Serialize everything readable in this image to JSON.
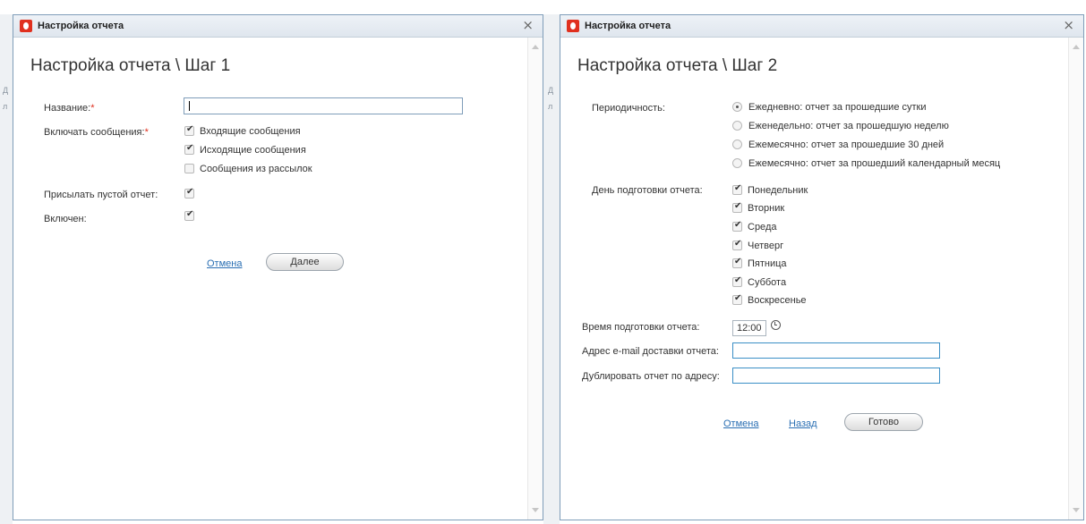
{
  "background": {
    "glimpse_left": [
      "Д",
      "л"
    ],
    "glimpse_right": [
      "Д",
      "л"
    ]
  },
  "dialog1": {
    "title": "Настройка отчета",
    "close": "×",
    "heading": "Настройка отчета \\ Шаг 1",
    "name_label": "Название:",
    "name_value": "",
    "include_label": "Включать сообщения:",
    "required_mark": "*",
    "messages": [
      {
        "label": "Входящие сообщения",
        "checked": true
      },
      {
        "label": "Исходящие сообщения",
        "checked": true
      },
      {
        "label": "Сообщения из рассылок",
        "checked": false
      }
    ],
    "send_empty_label": "Присылать пустой отчет:",
    "send_empty_checked": true,
    "enabled_label": "Включен:",
    "enabled_checked": true,
    "cancel_label": "Отмена",
    "next_label": "Далее"
  },
  "dialog2": {
    "title": "Настройка отчета",
    "close": "×",
    "heading": "Настройка отчета \\ Шаг 2",
    "periodicity_label": "Периодичность:",
    "periodicity_options": [
      {
        "label": "Ежедневно: отчет за прошедшие сутки",
        "selected": true
      },
      {
        "label": "Еженедельно: отчет за прошедшую неделю",
        "selected": false
      },
      {
        "label": "Ежемесячно: отчет за прошедшие 30 дней",
        "selected": false
      },
      {
        "label": "Ежемесячно: отчет за прошедший календарный месяц",
        "selected": false
      }
    ],
    "day_label": "День подготовки отчета:",
    "days": [
      {
        "label": "Понедельник",
        "checked": true
      },
      {
        "label": "Вторник",
        "checked": true
      },
      {
        "label": "Среда",
        "checked": true
      },
      {
        "label": "Четверг",
        "checked": true
      },
      {
        "label": "Пятница",
        "checked": true
      },
      {
        "label": "Суббота",
        "checked": true
      },
      {
        "label": "Воскресенье",
        "checked": true
      }
    ],
    "time_label": "Время подготовки отчета:",
    "time_value": "12:00",
    "email_label": "Адрес e-mail доставки отчета:",
    "email_value": "",
    "dup_label": "Дублировать отчет по адресу:",
    "dup_value": "",
    "cancel_label": "Отмена",
    "back_label": "Назад",
    "done_label": "Готово"
  },
  "colors": {
    "accent": "#e0301e",
    "link": "#2a6fb3",
    "border": "#7f9db9"
  }
}
